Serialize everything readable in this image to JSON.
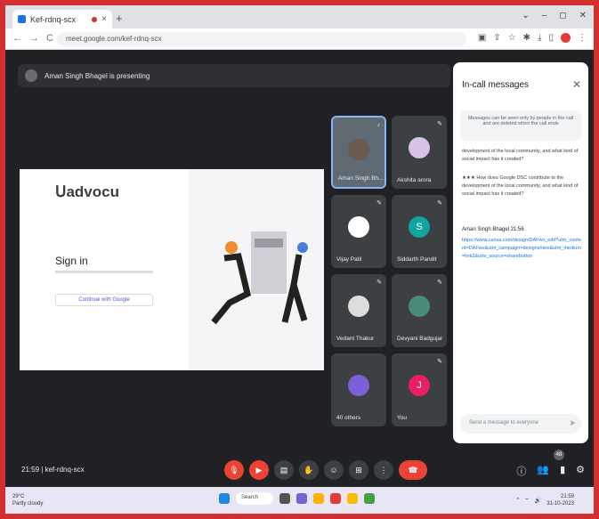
{
  "browser": {
    "tab_title": "Kef-rdnq-scx",
    "url": "meet.google.com/kef-rdnq-scx"
  },
  "presenter_bar": {
    "text": "Aman Singh Bhagel is presenting"
  },
  "slide": {
    "brand": "advocu",
    "heading": "Sign in",
    "google_button": "Continue with Google"
  },
  "participants": [
    {
      "name": "Aman Singh Bh...",
      "initial": "",
      "color": "#6b5a4e"
    },
    {
      "name": "Akshita arora",
      "initial": "",
      "color": "#d7c3e6"
    },
    {
      "name": "Vijay Patil",
      "initial": "",
      "color": "#ffffff"
    },
    {
      "name": "Siddarth Pandit",
      "initial": "S",
      "color": "#12a4a0"
    },
    {
      "name": "Vedant Thakur",
      "initial": "",
      "color": "#dddddd"
    },
    {
      "name": "Devyani Badgujar",
      "initial": "",
      "color": "#4a8a7a"
    },
    {
      "name": "40 others",
      "initial": "",
      "color": "#7b61d6"
    },
    {
      "name": "You",
      "initial": "J",
      "color": "#e91e63"
    }
  ],
  "chat": {
    "header": "In-call messages",
    "info": "Messages can be seen only by people in the call and are deleted when the call ends",
    "msg1": "development of the local community, and what kind of social impact has it created?",
    "msg2": "How does Google DSC contribute to the development of the local community, and what kind of social impact has it created?",
    "sender": "Aman Singh Bhagel",
    "sender_time": "21:56",
    "link": "https://www.canva.com/design/DAFwv_edit?utm_content=DAFwv&utm_campaign=designshare&utm_medium=link2&utm_source=sharebutton",
    "input_placeholder": "Send a message to everyone"
  },
  "bottom": {
    "clock": "21:59",
    "meeting_code": "kef-rdnq-scx",
    "people_count": "48"
  },
  "taskbar": {
    "weather_temp": "29°C",
    "weather_desc": "Partly cloudy",
    "search": "Search",
    "time": "21:59",
    "date": "31-10-2023"
  }
}
